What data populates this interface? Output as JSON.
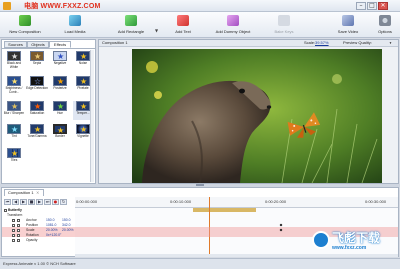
{
  "window": {
    "title": "Express Animate",
    "watermark": "电脑 WWW.FXXZ.COM",
    "buttons": {
      "minimize": "–",
      "maximize": "□",
      "close": "✕"
    }
  },
  "toolbar": {
    "new_composition": "New Composition",
    "load_media": "Load Media",
    "add_rectangle": "Add Rectangle",
    "add_text": "Add Text",
    "add_dummy_object": "Add Dummy Object",
    "bake_keys": "Bake Keys",
    "save_video": "Save Video",
    "options": "Options"
  },
  "left_panel": {
    "tabs": [
      "Sources",
      "Objects",
      "Effects"
    ],
    "active_tab": "Effects",
    "effects": [
      "Black and White",
      "Sepia",
      "Negative",
      "Noise",
      "Brightness / Contr...",
      "Edge Detection",
      "Posterize",
      "Pixelate",
      "Blur / Sharpen",
      "Saturation",
      "Hue",
      "Temper...",
      "Tint",
      "Tone/Gamma",
      "Border",
      "Vignette",
      "Tiles"
    ]
  },
  "preview": {
    "composition_label": "Composition 1",
    "scale_label": "Scale:",
    "scale_value": "39.57%",
    "quality_label": "Preview Quality:"
  },
  "timeline": {
    "tab_label": "Composition 1",
    "current_time": "0:00:00.000",
    "ticks": [
      "0:00:00.000",
      "0:00:10.000",
      "0:00:20.000",
      "0:00:30.000"
    ],
    "layers": [
      {
        "name": "Butterfly",
        "sub": "",
        "v1": "",
        "v2": ""
      },
      {
        "name": "Transform",
        "sub": "",
        "v1": "",
        "v2": ""
      },
      {
        "name": "",
        "sub": "Anchor",
        "v1": "150.0",
        "v2": "150.0"
      },
      {
        "name": "",
        "sub": "Position",
        "v1": "1081.0",
        "v2": "342.0"
      },
      {
        "name": "",
        "sub": "Scale",
        "v1": "20.00%",
        "v2": "20.00%"
      },
      {
        "name": "",
        "sub": "Rotation",
        "v1": "0x+120.0°",
        "v2": ""
      },
      {
        "name": "",
        "sub": "Opacity",
        "v1": "",
        "v2": ""
      }
    ]
  },
  "status_bar": "Express Animate v 1.00 © NCH Software",
  "colors": {
    "accent": "#1d7fd0",
    "brand_red": "#e0301e",
    "playhead": "#e07a2a",
    "clip": "#d8b765"
  },
  "corner_watermark": {
    "text": "飞彪下载",
    "url": "www.fxxz.com"
  }
}
